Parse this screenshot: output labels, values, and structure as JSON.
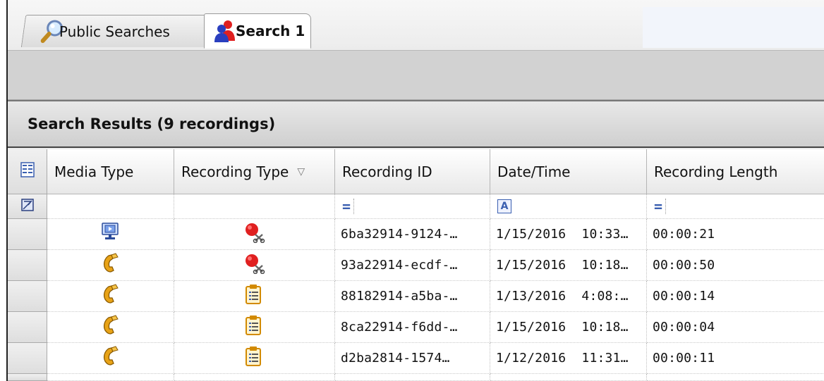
{
  "tabs": [
    {
      "label": "Public Searches",
      "icon": "magnifier-icon",
      "active": false
    },
    {
      "label": "Search 1",
      "icon": "users-icon",
      "active": true
    }
  ],
  "results": {
    "title": "Search Results (9 recordings)"
  },
  "columns": [
    {
      "label": "Media Type"
    },
    {
      "label": "Recording Type",
      "sorted": "descending"
    },
    {
      "label": "Recording ID"
    },
    {
      "label": "Date/Time"
    },
    {
      "label": "Recording Length"
    }
  ],
  "filters": {
    "recording_id_op": "=",
    "datetime_op": "A",
    "length_op": "="
  },
  "rows": [
    {
      "media_icon": "screen-recording-icon",
      "type_icon": "recording-cut-icon",
      "id": "6ba32914-9124-…",
      "datetime": "1/15/2016  10:33…",
      "length": "00:00:21"
    },
    {
      "media_icon": "phone-icon",
      "type_icon": "recording-cut-icon",
      "id": "93a22914-ecdf-…",
      "datetime": "1/15/2016  10:18…",
      "length": "00:00:50"
    },
    {
      "media_icon": "phone-icon",
      "type_icon": "clipboard-icon",
      "id": "88182914-a5ba-…",
      "datetime": "1/13/2016  4:08:…",
      "length": "00:00:14"
    },
    {
      "media_icon": "phone-icon",
      "type_icon": "clipboard-icon",
      "id": "8ca22914-f6dd-…",
      "datetime": "1/15/2016  10:18…",
      "length": "00:00:04"
    },
    {
      "media_icon": "phone-icon",
      "type_icon": "clipboard-icon",
      "id": "d2ba2814-1574…",
      "datetime": "1/12/2016  11:31…",
      "length": "00:00:11"
    }
  ],
  "colors": {
    "phone": "#e8a317",
    "record_red": "#e02020",
    "accent_blue": "#3a5fb0"
  }
}
